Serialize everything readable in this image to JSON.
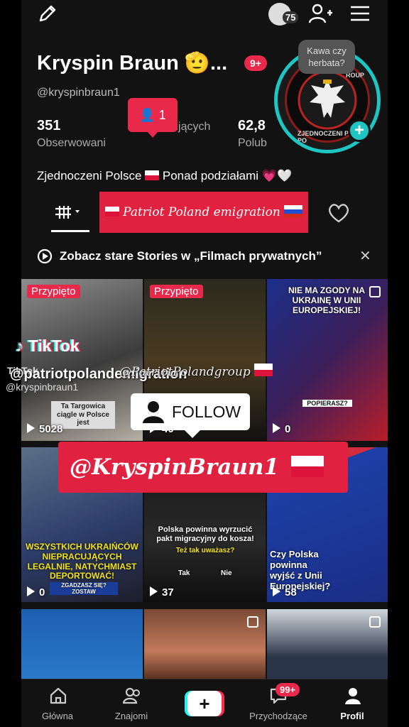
{
  "topbar": {
    "coin_count": "75"
  },
  "profile": {
    "name": "Kryspin Braun 🫡...",
    "notification_badge": "9+",
    "handle": "@kryspinbraun1",
    "kawa_bubble": "Kawa czy herbata?",
    "new_followers_count": "1",
    "stats": [
      {
        "value": "351",
        "label": "Obserwowani"
      },
      {
        "value": "",
        "label": "Obserwujących"
      },
      {
        "value": "62,8",
        "label": "Polub"
      }
    ],
    "bio": "Zjednoczeni Polsce",
    "bio_rest": "Ponad podziałami",
    "bio_hearts": "💗🤍",
    "avatar_text_top": "ROUP",
    "avatar_text_bottom": "ZJEDNOCZENI PONAD PO"
  },
  "promo_banner": "Patriot Poland emigration",
  "stories_notice": {
    "text": "Zobacz stare Stories w „Filmach prywatnych”",
    "close": "✕"
  },
  "videos": [
    {
      "pinned": "Przypięto",
      "views": "5028",
      "caption": "Ta Targowica ciągle w Polsce jest"
    },
    {
      "pinned": "Przypięto",
      "views": "40",
      "caption": ""
    },
    {
      "views": "0",
      "caption": "NIE MA ZGODY NA UKRAINĘ W UNII EUROPEJSKIEJ!",
      "sub": "POPIERASZ?"
    },
    {
      "views": "0",
      "caption": "WSZYSTKICH UKRAIŃCÓW NIEPRACUJĄCYCH LEGALNIE, NATYCHMIAST DEPORTOWAĆ!",
      "sub": "ZGADZASZ SIĘ? ZOSTAW"
    },
    {
      "views": "37",
      "caption": "Polska powinna wyrzucić pakt migracyjny do kosza!",
      "sub": "Też tak uważasz?",
      "yes": "Tak",
      "no": "Nie"
    },
    {
      "views": "58",
      "caption": "Czy Polska powinna wyjść z Unii Europejskiej?"
    }
  ],
  "overlay": {
    "tiktok": "TikTok",
    "tiktok_small": "TikTok",
    "big_handle": "@patriotpolandemigration",
    "small_handle": "@kryspinbraun1",
    "group_tag": "@PatriotPolandgroup",
    "follow": "FOLLOW",
    "braun_banner": "@KryspinBraun1"
  },
  "bottom_nav": {
    "home": "Główna",
    "friends": "Znajomi",
    "plus": "+",
    "inbox": "Przychodzące",
    "inbox_badge": "99+",
    "profile": "Profil"
  },
  "colors": {
    "accent_red": "#e8294c",
    "avatar_ring": "#1dc5c3",
    "background": "#121212"
  }
}
